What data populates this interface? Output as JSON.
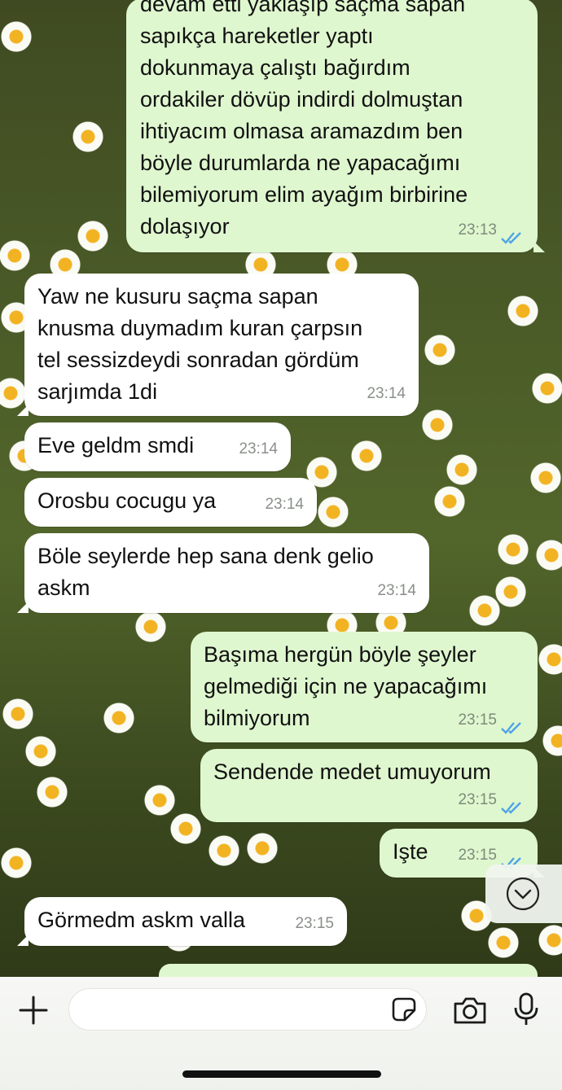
{
  "colors": {
    "incoming_bubble": "#ffffff",
    "outgoing_bubble": "#dff7cf",
    "read_ticks": "#4fa3e8",
    "timestamp": "#8a8f89"
  },
  "messages": [
    {
      "direction": "out",
      "text": "devam etti yaklaşıp saçma sapan\nsapıkça hareketler yaptı\ndokunmaya çalıştı bağırdım\nordakiler  dövüp indirdi dolmuştan\nihtiyacım olmasa aramazdım ben\nböyle durumlarda ne yapacağımı\nbilemiyorum elim ayağım birbirine\ndolaşıyor",
      "time": "23:13",
      "status": "read"
    },
    {
      "direction": "in",
      "text": "Yaw ne kusuru saçma sapan\nknusma duymadım kuran çarpsın\ntel sessizdeydi sonradan gördüm\nsarjımda 1di",
      "time": "23:14"
    },
    {
      "direction": "in",
      "text": "Eve geldm smdi",
      "time": "23:14"
    },
    {
      "direction": "in",
      "text": "Orosbu cocugu ya",
      "time": "23:14"
    },
    {
      "direction": "in",
      "text": "Böle seylerde hep sana denk gelio\naskm",
      "time": "23:14"
    },
    {
      "direction": "out",
      "text": "Başıma hergün böyle şeyler\ngelmediği için ne yapacağımı\nbilmiyorum",
      "time": "23:15",
      "status": "read"
    },
    {
      "direction": "out",
      "text": "Sendende medet umuyorum",
      "time": "23:15",
      "status": "read"
    },
    {
      "direction": "out",
      "text": "Işte",
      "time": "23:15",
      "status": "read"
    },
    {
      "direction": "in",
      "text": "Görmedm askm valla",
      "time": "23:15"
    }
  ],
  "input_bar": {
    "attach_icon": "plus-icon",
    "sticker_icon": "sticker-icon",
    "camera_icon": "camera-icon",
    "mic_icon": "microphone-icon",
    "message_value": ""
  },
  "scroll_down_icon": "chevron-down-circle-icon"
}
